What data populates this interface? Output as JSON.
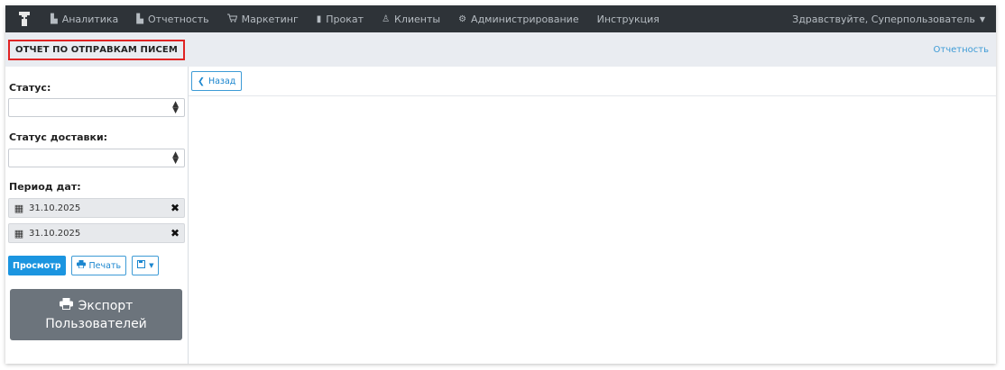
{
  "nav": {
    "items": [
      {
        "icon": "bar-chart-icon",
        "glyph": "▙",
        "label": "Аналитика"
      },
      {
        "icon": "bar-chart-icon",
        "glyph": "▙",
        "label": "Отчетность"
      },
      {
        "icon": "cart-icon",
        "glyph": "🛒",
        "label": "Маркетинг"
      },
      {
        "icon": "book-icon",
        "glyph": "▮",
        "label": "Прокат"
      },
      {
        "icon": "users-icon",
        "glyph": "♙",
        "label": "Клиенты"
      },
      {
        "icon": "cogs-icon",
        "glyph": "⚙",
        "label": "Администрирование"
      },
      {
        "icon": "",
        "glyph": "",
        "label": "Инструкция"
      }
    ],
    "greeting": "Здравствуйте, Суперпользователь"
  },
  "header": {
    "title": "ОТЧЕТ ПО ОТПРАВКАМ ПИСЕМ",
    "breadcrumb": "Отчетность"
  },
  "filters": {
    "status_label": "Статус:",
    "status_value": "",
    "delivery_label": "Статус доставки:",
    "delivery_value": "",
    "period_label": "Период дат:",
    "date_from": "31.10.2025",
    "date_to": "31.10.2025"
  },
  "actions": {
    "view": "Просмотр",
    "print": "Печать",
    "export_line1": "Экспорт",
    "export_line2": "Пользователей"
  },
  "main": {
    "back": "Назад"
  },
  "colors": {
    "nav_bg": "#2e3338",
    "header_bg": "#e9ecf1",
    "primary": "#1b95e0",
    "title_border": "#e02424",
    "export_bg": "#6c747c"
  }
}
